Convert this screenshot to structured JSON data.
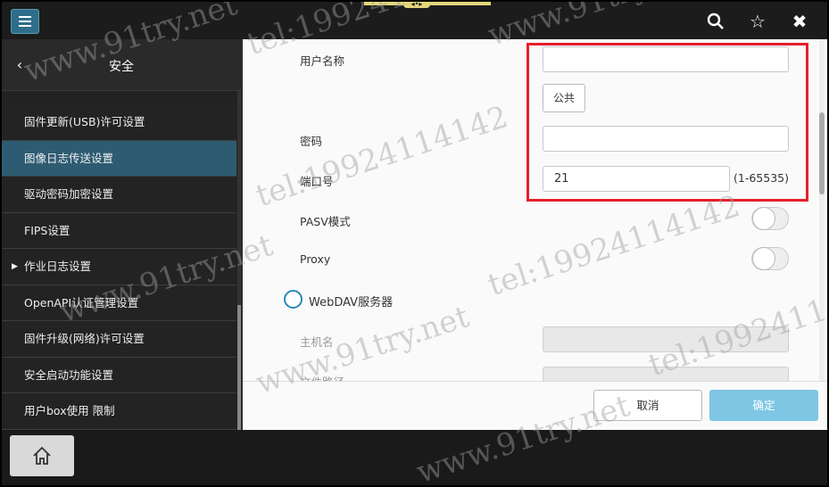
{
  "sidebar": {
    "title": "安全",
    "items": [
      {
        "label": "固件更新(USB)许可设置",
        "active": false,
        "expandable": false
      },
      {
        "label": "图像日志传送设置",
        "active": true,
        "expandable": false
      },
      {
        "label": "驱动密码加密设置",
        "active": false,
        "expandable": false
      },
      {
        "label": "FIPS设置",
        "active": false,
        "expandable": false
      },
      {
        "label": "作业日志设置",
        "active": false,
        "expandable": true
      },
      {
        "label": "OpenAPI认证管理设置",
        "active": false,
        "expandable": false
      },
      {
        "label": "固件升级(网络)许可设置",
        "active": false,
        "expandable": false
      },
      {
        "label": "安全启动功能设置",
        "active": false,
        "expandable": false
      },
      {
        "label": "用户box使用 限制",
        "active": false,
        "expandable": false
      }
    ]
  },
  "form": {
    "username_label": "用户名称",
    "username_value": "",
    "public_button": "公共",
    "password_label": "密码",
    "password_value": "",
    "port_label": "端口号",
    "port_value": "21",
    "port_range": "(1-65535)",
    "pasv_label": "PASV模式",
    "proxy_label": "Proxy",
    "webdav_label": "WebDAV服务器",
    "hostname_label": "主机名",
    "filepath_label": "文件路径"
  },
  "footer": {
    "cancel": "取消",
    "ok": "确定"
  },
  "watermarks": {
    "tel": "tel:19924114142",
    "site": "www.91try.net"
  },
  "colors": {
    "active_item": "#2d5c72",
    "ok_button": "#7ec6e4",
    "highlight": "#e5202a",
    "radio": "#2a88b8"
  },
  "icons": [
    "menu-icon",
    "search-icon",
    "star-icon",
    "close-icon",
    "back-icon",
    "home-icon"
  ]
}
